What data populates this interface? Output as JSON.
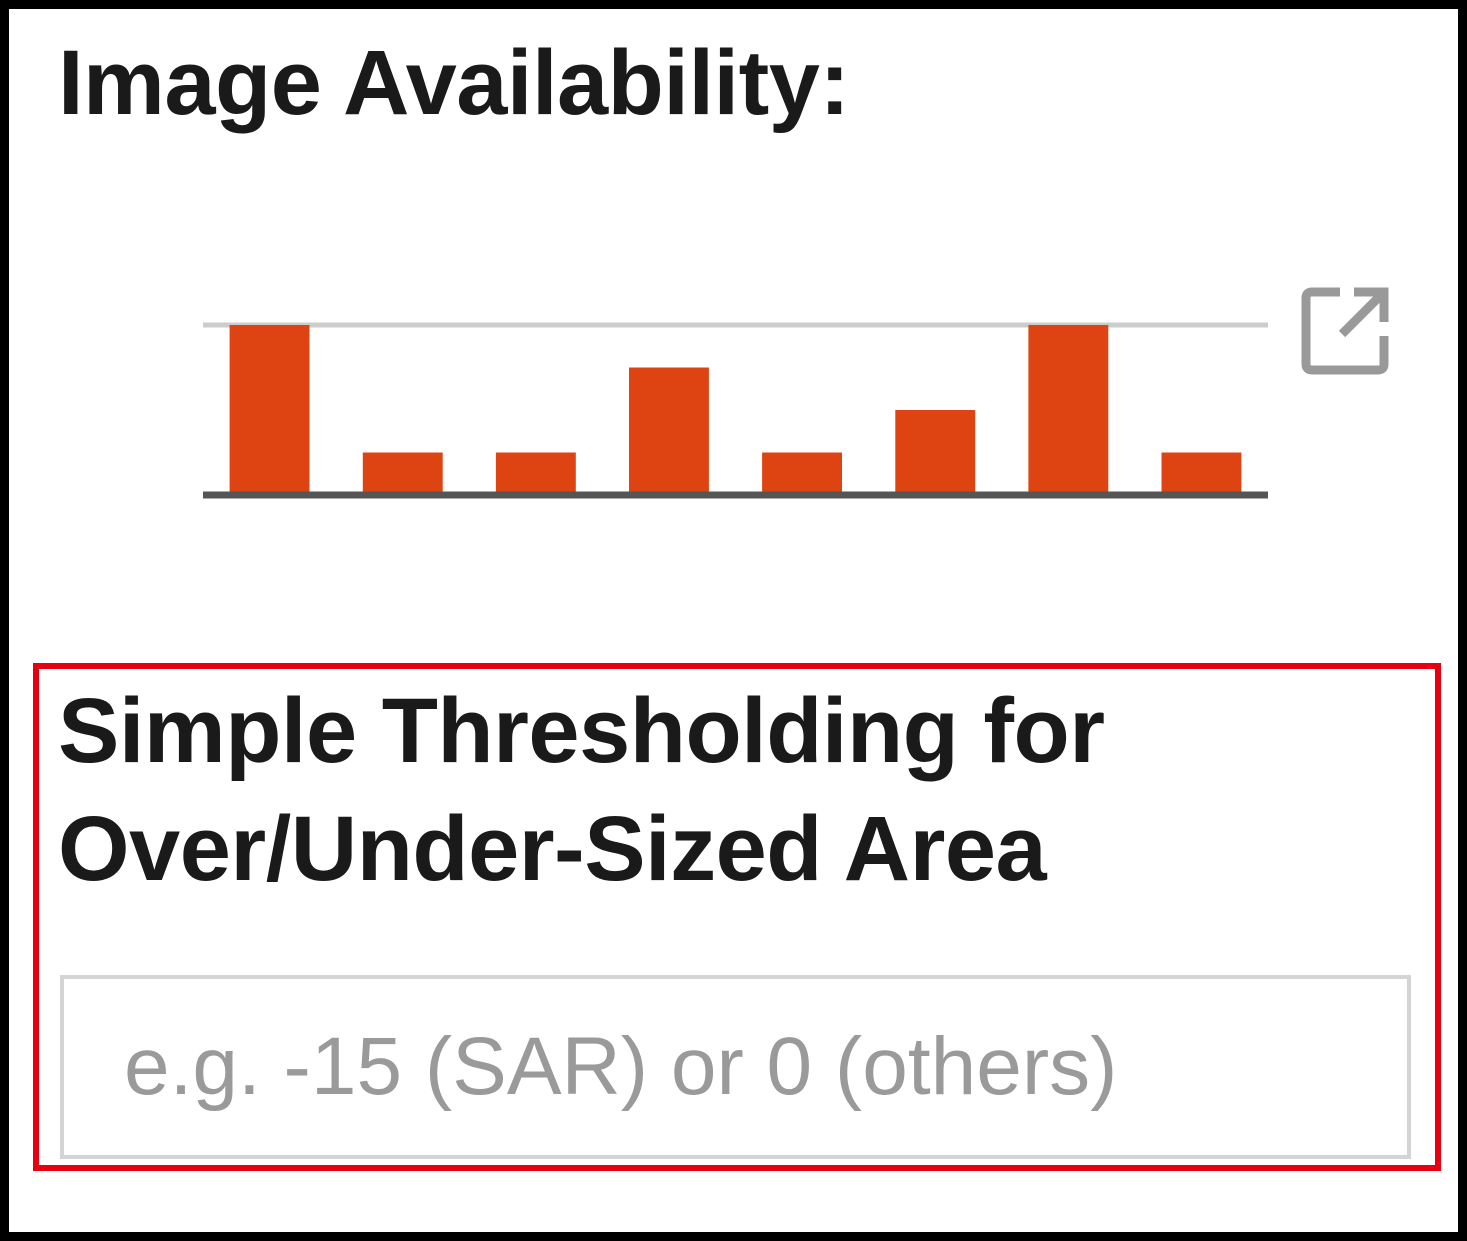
{
  "availability": {
    "title": "Image Availability:",
    "open_icon": "open-in-new-icon",
    "colors": {
      "bar": "#dd4411",
      "baseline": "#555555",
      "gridline": "#cccccc",
      "icon": "#999999"
    }
  },
  "chart_data": {
    "type": "bar",
    "title": "",
    "xlabel": "",
    "ylabel": "",
    "categories": [
      "",
      "",
      "",
      "",
      "",
      "",
      "",
      ""
    ],
    "values": [
      4,
      1,
      1,
      3,
      1,
      2,
      4,
      1
    ],
    "ylim": [
      0,
      4
    ],
    "grid": true,
    "legend": "none"
  },
  "threshold": {
    "title_line1": "Simple Thresholding for",
    "title_line2": "Over/Under-Sized Area",
    "input_value": "",
    "input_placeholder": "e.g. -15 (SAR) or 0 (others)",
    "highlight_color": "#e60012"
  }
}
